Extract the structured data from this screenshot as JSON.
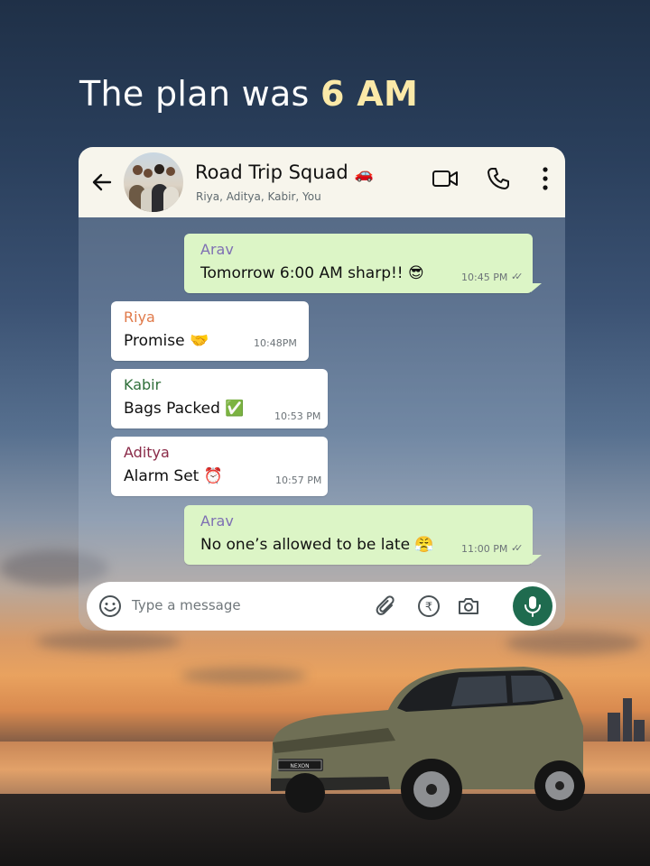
{
  "headline": {
    "prefix": "The plan was ",
    "highlight": "6 AM"
  },
  "chat": {
    "title": "Road Trip Squad",
    "title_emoji": "🚗",
    "members": "Riya, Aditya, Kabir, You",
    "icons": [
      "back-arrow-icon",
      "video-call-icon",
      "phone-icon",
      "more-options-icon"
    ],
    "messages": [
      {
        "sender": "Arav",
        "text": "Tomorrow 6:00 AM sharp!! 😎",
        "time": "10:45 PM",
        "direction": "out"
      },
      {
        "sender": "Riya",
        "text": "Promise 🤝",
        "time": "10:48PM",
        "direction": "in"
      },
      {
        "sender": "Kabir",
        "text": "Bags Packed ✅",
        "time": "10:53 PM",
        "direction": "in"
      },
      {
        "sender": "Aditya",
        "text": "Alarm Set ⏰",
        "time": "10:57 PM",
        "direction": "in"
      },
      {
        "sender": "Arav",
        "text": "No one’s allowed to be late 😤",
        "time": "11:00 PM",
        "direction": "out"
      }
    ],
    "input": {
      "placeholder": "Type a message"
    },
    "sender_colors": {
      "Arav": "#7e6fb3",
      "Riya": "#e07a4a",
      "Kabir": "#2f6f3a",
      "Aditya": "#8a2a48"
    },
    "accent": "#1f6b4f"
  },
  "car": {
    "badge": "NEXON"
  }
}
